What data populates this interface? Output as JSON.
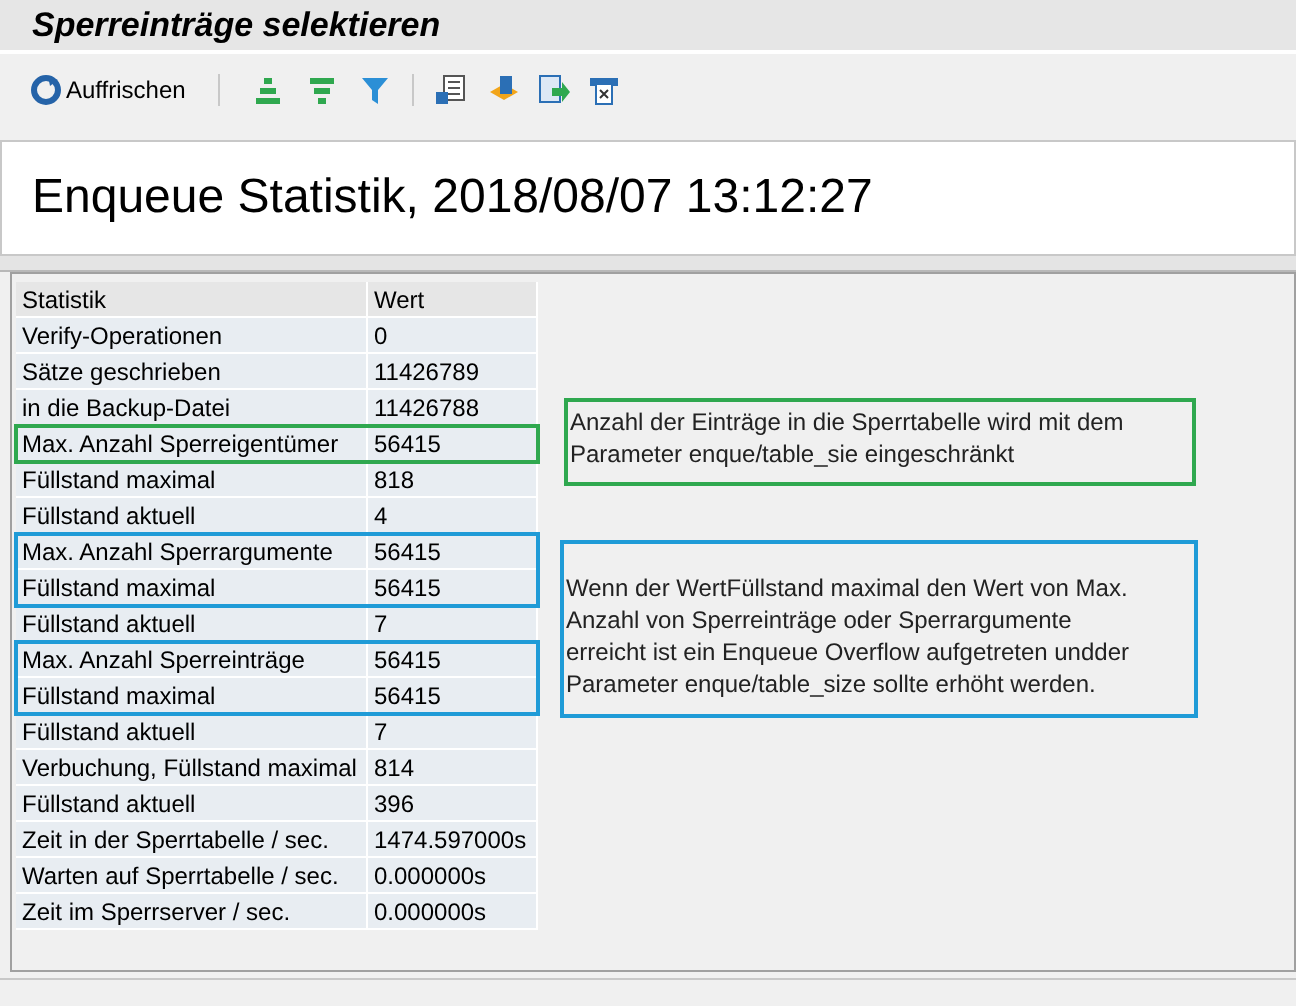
{
  "window": {
    "title": "Sperreinträge selektieren"
  },
  "toolbar": {
    "refresh_label": "Auffrischen"
  },
  "heading": "Enqueue Statistik, 2018/08/07 13:12:27",
  "table": {
    "columns": [
      "Statistik",
      "Wert"
    ],
    "rows": [
      {
        "label": "Verify-Operationen",
        "value": "0"
      },
      {
        "label": "Sätze geschrieben",
        "value": "11426789"
      },
      {
        "label": "in die Backup-Datei",
        "value": "11426788"
      },
      {
        "label": "Max. Anzahl Sperreigentümer",
        "value": "56415",
        "color": "#2fa84f"
      },
      {
        "label": "Füllstand maximal",
        "value": "818"
      },
      {
        "label": "Füllstand aktuell",
        "value": "4"
      },
      {
        "label": "Max. Anzahl Sperrargumente",
        "value": "56415",
        "color": "#1f9bd7"
      },
      {
        "label": "Füllstand maximal",
        "value": "56415",
        "color": "#1f9bd7"
      },
      {
        "label": "Füllstand aktuell",
        "value": "7"
      },
      {
        "label": "Max. Anzahl Sperreinträge",
        "value": "56415",
        "color": "#1f9bd7"
      },
      {
        "label": "Füllstand maximal",
        "value": "56415",
        "color": "#1f9bd7"
      },
      {
        "label": "Füllstand aktuell",
        "value": "7"
      },
      {
        "label": "Verbuchung, Füllstand maximal",
        "value": "814"
      },
      {
        "label": "Füllstand aktuell",
        "value": "396"
      },
      {
        "label": "Zeit in der Sperrtabelle / sec.",
        "value": "1474.597000s"
      },
      {
        "label": "Warten auf Sperrtabelle / sec.",
        "value": "0.000000s"
      },
      {
        "label": "Zeit im Sperrserver / sec.",
        "value": "0.000000s"
      }
    ]
  },
  "notes": [
    {
      "text": "Anzahl der Einträge in die Sperrtabelle wird mit dem Parameter enque/table_sie eingeschränkt",
      "color": "#2fa84f"
    },
    {
      "text": "Wenn der WertFüllstand maximal den Wert von Max. Anzahl von Sperreinträge oder Sperrargumente erreicht ist ein Enqueue Overflow aufgetreten undder Parameter enque/table_size sollte erhöht werden.",
      "color": "#1f9bd7"
    }
  ]
}
